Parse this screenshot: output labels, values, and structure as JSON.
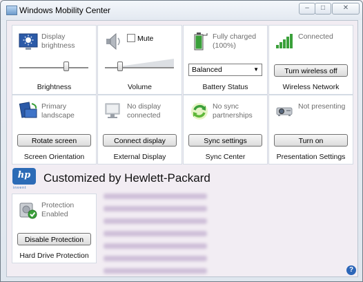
{
  "window": {
    "title": "Windows Mobility Center",
    "min_symbol": "–",
    "max_symbol": "□",
    "close_symbol": "✕"
  },
  "tiles": {
    "brightness": {
      "status": "Display brightness",
      "footer": "Brightness",
      "level": 0.7
    },
    "volume": {
      "mute_label": "Mute",
      "footer": "Volume",
      "level": 0.2,
      "muted": false
    },
    "battery": {
      "status": "Fully charged (100%)",
      "plan": "Balanced",
      "footer": "Battery Status"
    },
    "wireless": {
      "status": "Connected",
      "button": "Turn wireless off",
      "footer": "Wireless Network"
    },
    "orientation": {
      "status": "Primary landscape",
      "button": "Rotate screen",
      "footer": "Screen Orientation"
    },
    "display": {
      "status": "No display connected",
      "button": "Connect display",
      "footer": "External Display"
    },
    "sync": {
      "status": "No sync partnerships",
      "button": "Sync settings",
      "footer": "Sync Center"
    },
    "presentation": {
      "status": "Not presenting",
      "button": "Turn on",
      "footer": "Presentation Settings"
    },
    "harddrive": {
      "status": "Protection Enabled",
      "button": "Disable Protection",
      "footer": "Hard Drive Protection"
    }
  },
  "hp": {
    "logo": "hp",
    "sub": "invent",
    "title": "Customized by Hewlett-Packard"
  },
  "help": {
    "label": "?"
  },
  "colors": {
    "accent": "#2c6bb6",
    "signal_green": "#3aa03a"
  }
}
